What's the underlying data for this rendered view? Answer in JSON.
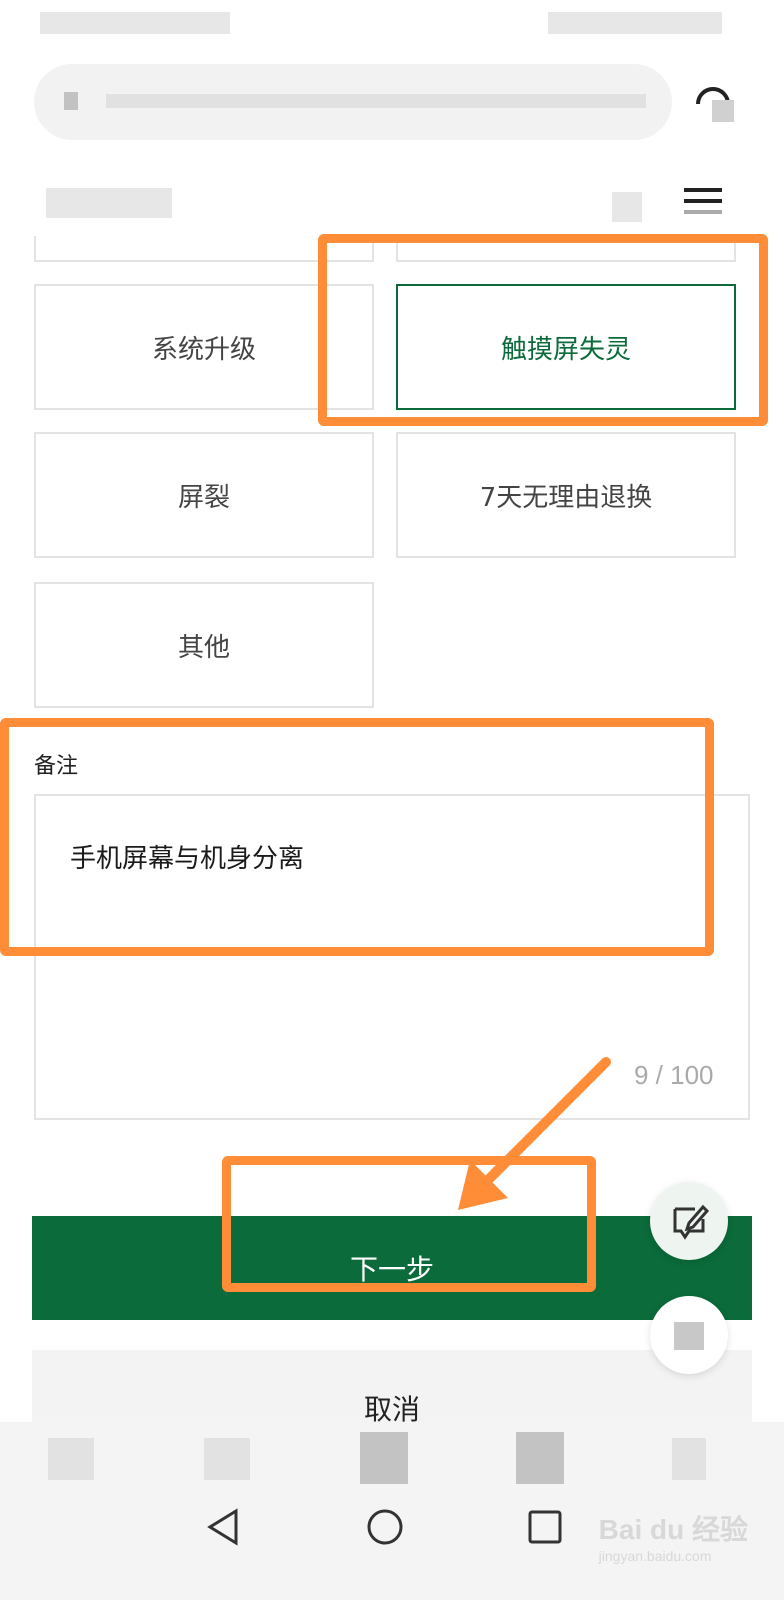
{
  "options": [
    {
      "label": "系统升级",
      "selected": false
    },
    {
      "label": "触摸屏失灵",
      "selected": true
    },
    {
      "label": "屏裂",
      "selected": false
    },
    {
      "label": "7天无理由退换",
      "selected": false
    },
    {
      "label": "其他",
      "selected": false
    }
  ],
  "remark": {
    "label": "备注",
    "value": "手机屏幕与机身分离",
    "counter": "9 / 100"
  },
  "buttons": {
    "next": "下一步",
    "cancel": "取消"
  },
  "watermark": {
    "brand": "Bai du 经验",
    "url": "jingyan.baidu.com"
  },
  "colors": {
    "primary_green": "#0b6b3a",
    "annotation_orange": "#ff8c37"
  },
  "icons": {
    "nav_back": "back-triangle-icon",
    "nav_home": "home-circle-icon",
    "nav_recent": "recent-square-icon",
    "fab": "feedback-edit-icon"
  }
}
